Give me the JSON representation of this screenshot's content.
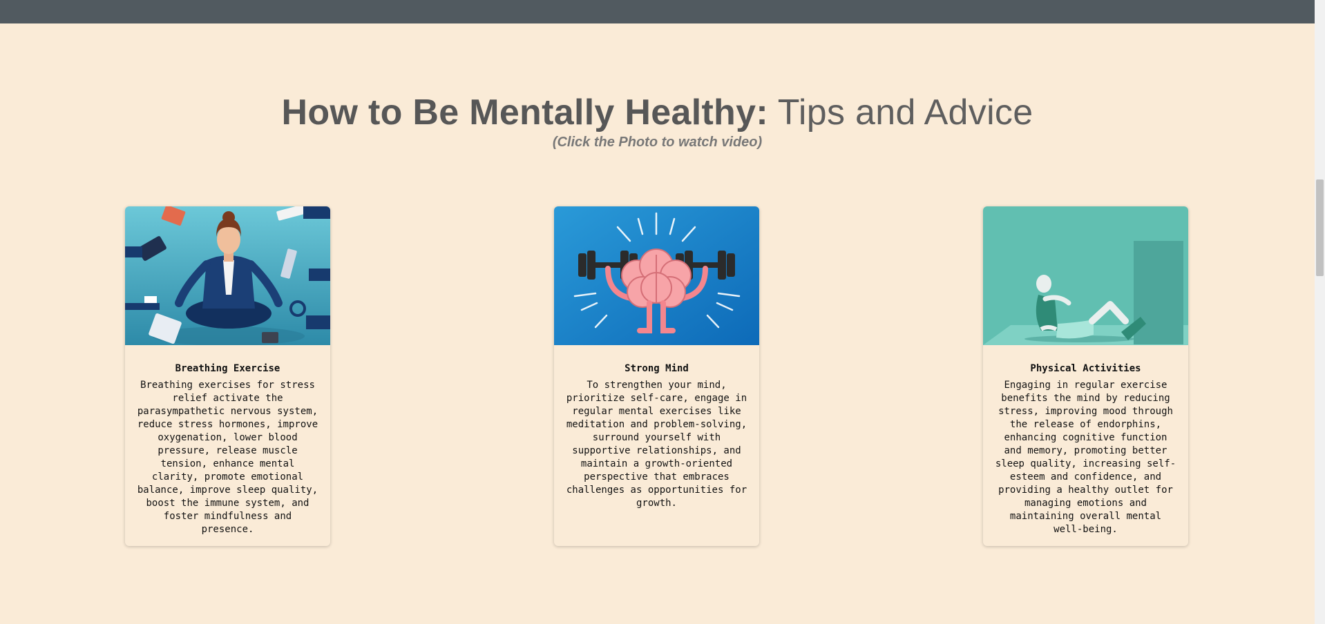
{
  "header": {
    "title_strong": "How to Be Mentally Healthy:",
    "title_light": " Tips and Advice",
    "subtitle": "(Click the Photo to watch video)"
  },
  "cards": [
    {
      "title": "Breathing Exercise",
      "text": "Breathing exercises for stress relief activate the parasympathetic nervous system, reduce stress hormones, improve oxygenation, lower blood pressure, release muscle tension, enhance mental clarity, promote emotional balance, improve sleep quality, boost the immune system, and foster mindfulness and presence.",
      "image_icon": "meditation-illustration"
    },
    {
      "title": "Strong Mind",
      "text": "To strengthen your mind, prioritize self-care, engage in regular mental exercises like meditation and problem-solving, surround yourself with supportive relationships, and maintain a growth-oriented perspective that embraces challenges as opportunities for growth.",
      "image_icon": "brain-lifting-illustration"
    },
    {
      "title": "Physical Activities",
      "text": "Engaging in regular exercise benefits the mind by reducing stress, improving mood through the release of endorphins, enhancing cognitive function and memory, promoting better sleep quality, increasing self-esteem and confidence, and providing a healthy outlet for managing emotions and maintaining overall mental well-being.",
      "image_icon": "stretching-illustration"
    }
  ],
  "colors": {
    "background": "#faebd7",
    "top_bar": "#515a60",
    "heading": "#575757"
  }
}
